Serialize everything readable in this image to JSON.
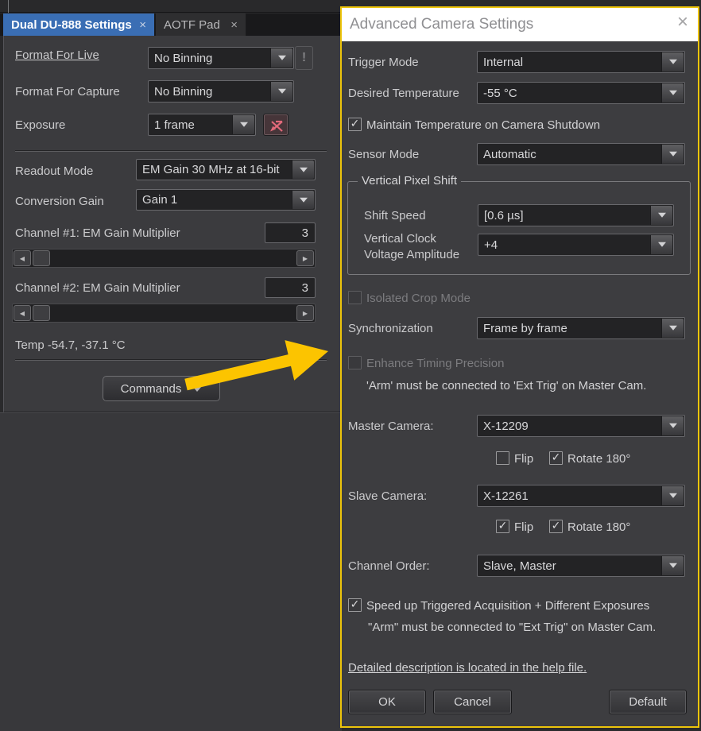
{
  "colors": {
    "accent_yellow": "#edc40b",
    "arrow_yellow": "#fcc400",
    "active_tab_blue": "#3a6eb4",
    "danger_red": "#e2697a",
    "dialog_title_bg": "#ffffff",
    "panel_bg": "#3b3b3e",
    "dialog_bg": "#3d3d40"
  },
  "icons": {
    "close": "×",
    "check": "✓",
    "left_arrow": "◀",
    "right_arrow": "▶",
    "alert": "!"
  },
  "left_panel": {
    "tabs": [
      {
        "label": "Dual DU-888 Settings"
      },
      {
        "label": "AOTF Pad"
      }
    ],
    "format_live_label": "Format For Live",
    "format_live_value": "No Binning",
    "format_capture_label": "Format For Capture",
    "format_capture_value": "No Binning",
    "exposure_label": "Exposure",
    "exposure_value": "1 frame",
    "readout_label": "Readout Mode",
    "readout_value": "EM Gain 30 MHz at 16-bit",
    "gain_label": "Conversion Gain",
    "gain_value": "Gain 1",
    "ch1_label": "Channel #1: EM Gain Multiplier",
    "ch1_value": "3",
    "ch2_label": "Channel #2: EM Gain Multiplier",
    "ch2_value": "3",
    "temp_text": "Temp -54.7, -37.1 °C",
    "commands_label": "Commands"
  },
  "dialog": {
    "title": "Advanced Camera Settings",
    "trigger_label": "Trigger Mode",
    "trigger_value": "Internal",
    "temp_label": "Desired Temperature",
    "temp_value": "-55 °C",
    "maintain_label": "Maintain Temperature on Camera Shutdown",
    "maintain_mark": "✓",
    "sensor_label": "Sensor Mode",
    "sensor_value": "Automatic",
    "vps_title": "Vertical Pixel Shift",
    "shift_label": "Shift Speed",
    "shift_value": "[0.6 µs]",
    "vcva_label": "Vertical Clock Voltage Amplitude",
    "vcva_value": "+4",
    "isolated_label": "Isolated Crop Mode",
    "isolated_mark": "",
    "sync_label": "Synchronization",
    "sync_value": "Frame by frame",
    "enhance_label": "Enhance Timing Precision",
    "enhance_mark": "",
    "arm_note_1": "'Arm' must be connected to 'Ext Trig' on Master Cam.",
    "master_label": "Master Camera:",
    "master_value": "X-12209",
    "master_flip_label": "Flip",
    "master_flip_mark": "",
    "master_rotate_label": "Rotate 180°",
    "master_rotate_mark": "✓",
    "slave_label": "Slave Camera:",
    "slave_value": "X-12261",
    "slave_flip_label": "Flip",
    "slave_flip_mark": "✓",
    "slave_rotate_label": "Rotate 180°",
    "slave_rotate_mark": "✓",
    "order_label": "Channel Order:",
    "order_value": "Slave, Master",
    "speedup_label": "Speed up Triggered Acquisition + Different Exposures",
    "speedup_mark": "✓",
    "arm_note_2": "\"Arm\" must be connected to \"Ext Trig\" on Master Cam.",
    "help_link": "Detailed description is located in the help file.",
    "ok_label": "OK",
    "cancel_label": "Cancel",
    "default_label": "Default"
  }
}
